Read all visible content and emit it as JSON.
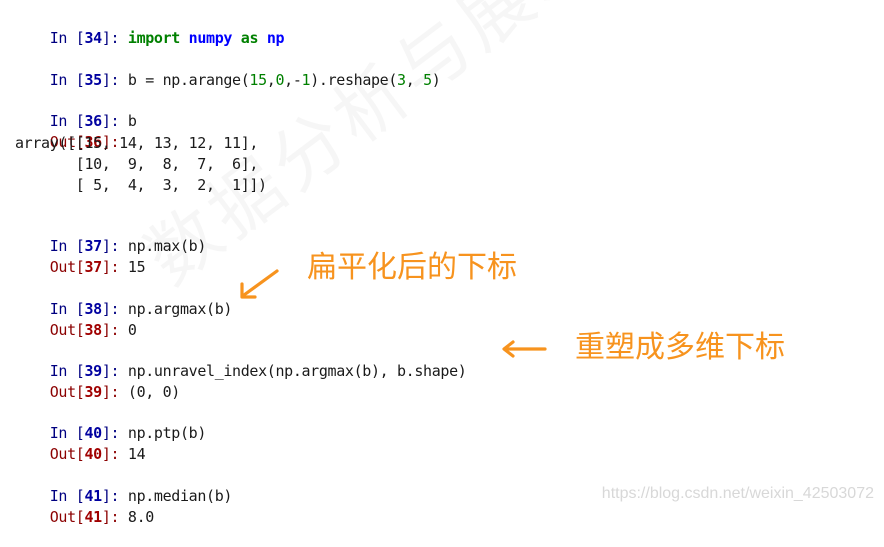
{
  "cells": [
    {
      "in_label": "In [",
      "number": "34",
      "close": "]: ",
      "code_parts": [
        {
          "text": "import",
          "cls": "kw"
        },
        {
          "text": " ",
          "cls": "code"
        },
        {
          "text": "numpy",
          "cls": "mod"
        },
        {
          "text": " ",
          "cls": "code"
        },
        {
          "text": "as",
          "cls": "kw"
        },
        {
          "text": " ",
          "cls": "code"
        },
        {
          "text": "np",
          "cls": "mod"
        }
      ]
    },
    {
      "in_label": "In [",
      "number": "35",
      "close": "]: ",
      "code_parts": [
        {
          "text": "b = np.arange(",
          "cls": "code"
        },
        {
          "text": "15",
          "cls": "numlit"
        },
        {
          "text": ",",
          "cls": "code"
        },
        {
          "text": "0",
          "cls": "numlit"
        },
        {
          "text": ",-",
          "cls": "code"
        },
        {
          "text": "1",
          "cls": "numlit"
        },
        {
          "text": ").reshape(",
          "cls": "code"
        },
        {
          "text": "3",
          "cls": "numlit"
        },
        {
          "text": ", ",
          "cls": "code"
        },
        {
          "text": "5",
          "cls": "numlit"
        },
        {
          "text": ")",
          "cls": "code"
        }
      ]
    },
    {
      "in_label": "In [",
      "number": "36",
      "close": "]: ",
      "code_parts": [
        {
          "text": "b",
          "cls": "code"
        }
      ],
      "out_label": "Out[",
      "out_close": "]:",
      "output_lines": [
        "array([[15, 14, 13, 12, 11],",
        "       [10,  9,  8,  7,  6],",
        "       [ 5,  4,  3,  2,  1]])"
      ]
    },
    {
      "in_label": "In [",
      "number": "37",
      "close": "]: ",
      "code_parts": [
        {
          "text": "np.max(b)",
          "cls": "code"
        }
      ],
      "out_label": "Out[",
      "out_close": "]: ",
      "output_inline": "15"
    },
    {
      "in_label": "In [",
      "number": "38",
      "close": "]: ",
      "code_parts": [
        {
          "text": "np.argmax(b)",
          "cls": "code"
        }
      ],
      "out_label": "Out[",
      "out_close": "]: ",
      "output_inline": "0"
    },
    {
      "in_label": "In [",
      "number": "39",
      "close": "]: ",
      "code_parts": [
        {
          "text": "np.unravel_index(np.argmax(b), b.shape)",
          "cls": "code"
        }
      ],
      "out_label": "Out[",
      "out_close": "]: ",
      "output_inline": "(0, 0)"
    },
    {
      "in_label": "In [",
      "number": "40",
      "close": "]: ",
      "code_parts": [
        {
          "text": "np.ptp(b)",
          "cls": "code"
        }
      ],
      "out_label": "Out[",
      "out_close": "]: ",
      "output_inline": "14"
    },
    {
      "in_label": "In [",
      "number": "41",
      "close": "]: ",
      "code_parts": [
        {
          "text": "np.median(b)",
          "cls": "code"
        }
      ],
      "out_label": "Out[",
      "out_close": "]: ",
      "output_inline": "8.0"
    }
  ],
  "annotations": {
    "flattened_index": "扁平化后的下标",
    "reshaped_index": "重塑成多维下标",
    "color": "#f7931e"
  },
  "watermark": {
    "url": "https://blog.csdn.net/weixin_42503072"
  }
}
